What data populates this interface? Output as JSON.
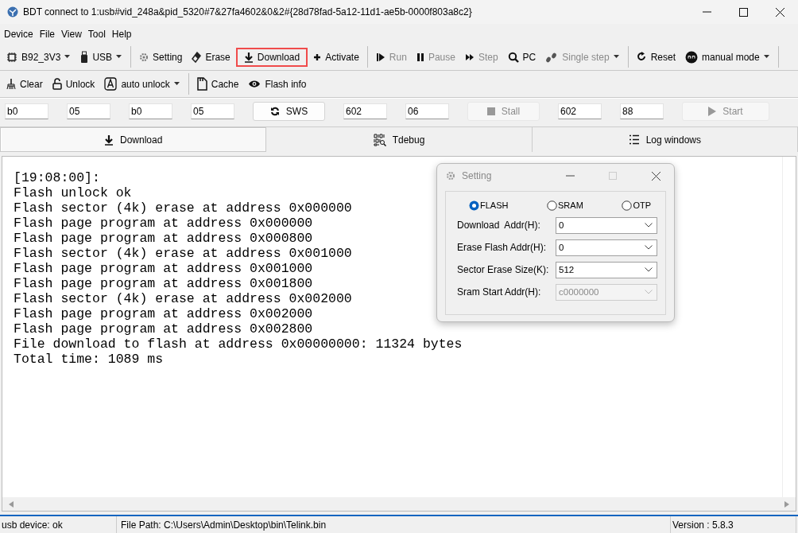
{
  "window": {
    "title": "BDT connect to 1:usb#vid_248a&pid_5320#7&27fa4602&0&2#{28d78fad-5a12-11d1-ae5b-0000f803a8c2}"
  },
  "menu": [
    "Device",
    "File",
    "View",
    "Tool",
    "Help"
  ],
  "toolbar": [
    [
      {
        "label": "B92_3V3",
        "kind": "dropdown",
        "disabled": false,
        "highlighted": false
      },
      {
        "label": "USB",
        "kind": "dropdown",
        "disabled": false,
        "highlighted": false
      }
    ],
    [
      {
        "label": "Setting",
        "kind": "button",
        "disabled": false,
        "highlighted": false
      },
      {
        "label": "Erase",
        "kind": "button",
        "disabled": false,
        "highlighted": false
      },
      {
        "label": "Download",
        "kind": "button",
        "disabled": false,
        "highlighted": true
      },
      {
        "label": "Activate",
        "kind": "button",
        "disabled": false,
        "highlighted": false
      }
    ],
    [
      {
        "label": "Run",
        "kind": "button",
        "disabled": true,
        "highlighted": false
      },
      {
        "label": "Pause",
        "kind": "button",
        "disabled": true,
        "highlighted": false
      },
      {
        "label": "Step",
        "kind": "button",
        "disabled": true,
        "highlighted": false
      },
      {
        "label": "PC",
        "kind": "button",
        "disabled": false,
        "highlighted": false
      },
      {
        "label": "Single step",
        "kind": "dropdown",
        "disabled": true,
        "highlighted": false
      }
    ],
    [
      {
        "label": "Reset",
        "kind": "button",
        "disabled": false,
        "highlighted": false
      },
      {
        "label": "manual mode",
        "kind": "dropdown",
        "disabled": false,
        "highlighted": false
      }
    ]
  ],
  "toolbar_2": [
    [
      {
        "label": "Clear",
        "kind": "button"
      },
      {
        "label": "Unlock",
        "kind": "button"
      },
      {
        "label": "auto unlock",
        "kind": "dropdown"
      }
    ],
    [
      {
        "label": "Cache",
        "kind": "button"
      },
      {
        "label": "Flash info",
        "kind": "button"
      }
    ]
  ],
  "command_row": [
    {
      "kind": "field",
      "value": "b0"
    },
    {
      "kind": "field",
      "value": "05"
    },
    {
      "kind": "field",
      "value": "b0"
    },
    {
      "kind": "field",
      "value": "05"
    },
    {
      "kind": "button",
      "label": "SWS",
      "disabled": false
    },
    {
      "kind": "field",
      "value": "602"
    },
    {
      "kind": "field",
      "value": "06"
    },
    {
      "kind": "button",
      "label": "Stall",
      "disabled": true
    },
    {
      "kind": "field",
      "value": "602"
    },
    {
      "kind": "field",
      "value": "88"
    },
    {
      "kind": "button",
      "label": "Start",
      "disabled": true
    }
  ],
  "tabs": [
    {
      "label": "Download",
      "selected": true
    },
    {
      "label": "Tdebug",
      "selected": false
    },
    {
      "label": "Log windows",
      "selected": false
    }
  ],
  "log": [
    "[19:08:00]:",
    "Flash unlock ok",
    "Flash sector (4k) erase at address 0x000000",
    "Flash page program at address 0x000000",
    "Flash page program at address 0x000800",
    "Flash sector (4k) erase at address 0x001000",
    "Flash page program at address 0x001000",
    "Flash page program at address 0x001800",
    "Flash sector (4k) erase at address 0x002000",
    "Flash page program at address 0x002000",
    "Flash page program at address 0x002800",
    "File download to flash at address 0x00000000: 11324 bytes",
    "Total time: 1089 ms"
  ],
  "dialog": {
    "title": "Setting",
    "radios": [
      {
        "label": "FLASH",
        "selected": true
      },
      {
        "label": "SRAM",
        "selected": false
      },
      {
        "label": "OTP",
        "selected": false
      }
    ],
    "rows": [
      {
        "label": "Download  Addr(H):",
        "value": "0",
        "disabled": false
      },
      {
        "label": "Erase Flash Addr(H):",
        "value": "0",
        "disabled": false
      },
      {
        "label": "Sector Erase Size(K):",
        "value": "512",
        "disabled": false
      },
      {
        "label": "Sram Start Addr(H):",
        "value": "c0000000",
        "disabled": true
      }
    ]
  },
  "status_bar": [
    "usb device: ok",
    "File Path:  C:\\Users\\Admin\\Desktop\\bin\\Telink.bin",
    "Version : 5.8.3"
  ]
}
